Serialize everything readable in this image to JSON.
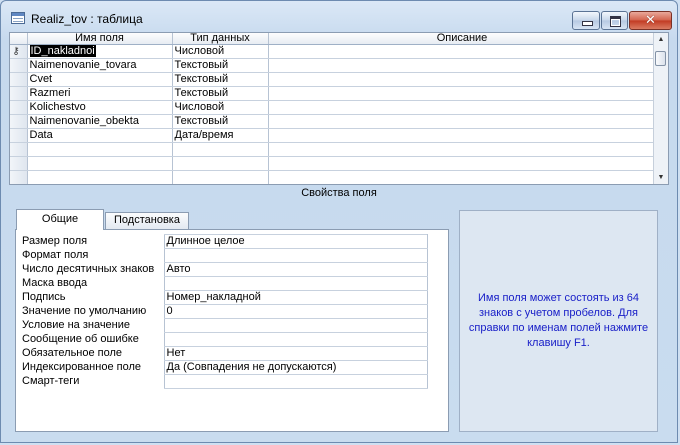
{
  "window": {
    "title": "Realiz_tov : таблица"
  },
  "grid": {
    "headers": [
      "Имя поля",
      "Тип данных",
      "Описание"
    ],
    "rows": [
      {
        "name": "ID_nakladnoi",
        "type": "Числовой",
        "desc": "",
        "key": true,
        "selected": true
      },
      {
        "name": "Naimenovanie_tovara",
        "type": "Текстовый",
        "desc": ""
      },
      {
        "name": "Cvet",
        "type": "Текстовый",
        "desc": ""
      },
      {
        "name": "Razmeri",
        "type": "Текстовый",
        "desc": ""
      },
      {
        "name": "Kolichestvo",
        "type": "Числовой",
        "desc": ""
      },
      {
        "name": "Naimenovanie_obekta",
        "type": "Текстовый",
        "desc": ""
      },
      {
        "name": "Data",
        "type": "Дата/время",
        "desc": ""
      },
      {
        "name": "",
        "type": "",
        "desc": ""
      },
      {
        "name": "",
        "type": "",
        "desc": ""
      },
      {
        "name": "",
        "type": "",
        "desc": ""
      }
    ]
  },
  "properties": {
    "title": "Свойства поля",
    "tabs": [
      "Общие",
      "Подстановка"
    ],
    "rows": [
      {
        "label": "Размер поля",
        "value": "Длинное целое"
      },
      {
        "label": "Формат поля",
        "value": ""
      },
      {
        "label": "Число десятичных знаков",
        "value": "Авто"
      },
      {
        "label": "Маска ввода",
        "value": ""
      },
      {
        "label": "Подпись",
        "value": "Номер_накладной"
      },
      {
        "label": "Значение по умолчанию",
        "value": "0"
      },
      {
        "label": "Условие на значение",
        "value": ""
      },
      {
        "label": "Сообщение об ошибке",
        "value": ""
      },
      {
        "label": "Обязательное поле",
        "value": "Нет"
      },
      {
        "label": "Индексированное поле",
        "value": "Да (Совпадения не допускаются)"
      },
      {
        "label": "Смарт-теги",
        "value": ""
      }
    ],
    "help": "Имя поля может состоять из 64 знаков с учетом пробелов.  Для справки по именам полей нажмите клавишу F1."
  },
  "icons": {
    "app": "table-icon",
    "key": "primary-key-icon",
    "minimize": "minimize-icon",
    "maximize": "maximize-icon",
    "close": "close-icon"
  },
  "colors": {
    "help_text": "#1a20c8",
    "close_button": "#c23a22"
  }
}
